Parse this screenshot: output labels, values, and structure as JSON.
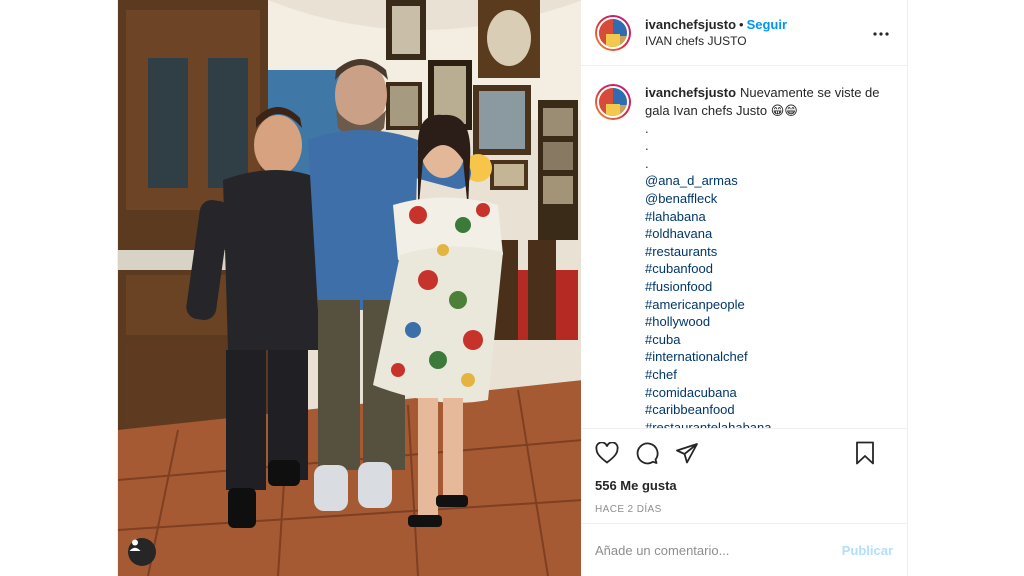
{
  "header": {
    "username": "ivanchefsjusto",
    "separator": "•",
    "follow_label": "Seguir",
    "location": "IVAN chefs JUSTO",
    "more_icon": "more-horizontal-icon"
  },
  "caption": {
    "username": "ivanchefsjusto",
    "text": "Nuevamente se viste de gala Ivan chefs Justo 😁😁",
    "dots": [
      ".",
      ".",
      "."
    ],
    "tags": [
      "@ana_d_armas",
      "@benaffleck",
      "#lahabana",
      "#oldhavana",
      "#restaurants",
      "#cubanfood",
      "#fusionfood",
      "#americanpeople",
      "#hollywood",
      "#cuba",
      "#internationalchef",
      "#chef",
      "#comidacubana",
      "#caribbeanfood",
      "#restaurantelahabana"
    ]
  },
  "actions": {
    "like_icon": "heart-icon",
    "comment_icon": "comment-icon",
    "share_icon": "share-icon",
    "save_icon": "bookmark-icon"
  },
  "likes": "556 Me gusta",
  "time": "HACE 2 DÍAS",
  "comment_box": {
    "placeholder": "Añade un comentario...",
    "publish_label": "Publicar"
  },
  "photo": {
    "tag_icon": "user-tag-icon"
  },
  "colors": {
    "link": "#0095f6",
    "hashtag": "#00376b",
    "muted": "#8e8e8e",
    "publish_disabled": "#b2dffc"
  }
}
